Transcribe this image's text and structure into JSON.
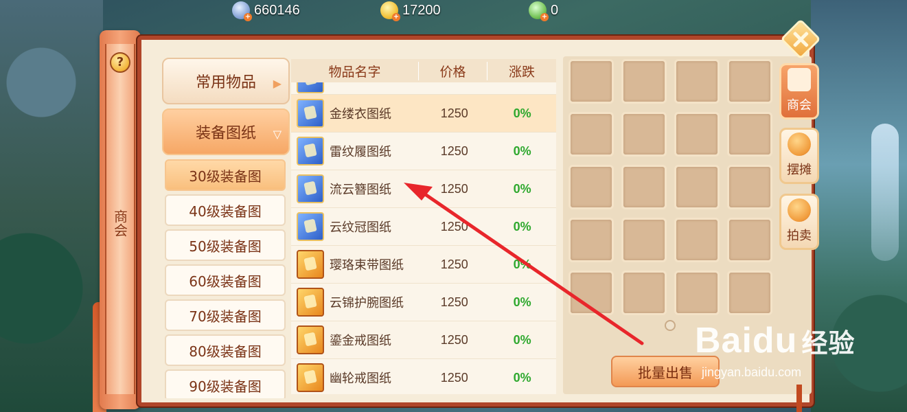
{
  "currencies": [
    {
      "icon": "silver-coin-icon",
      "value": "660146"
    },
    {
      "icon": "gold-coin-icon",
      "value": "17200"
    },
    {
      "icon": "jade-coin-icon",
      "value": "0"
    }
  ],
  "spine": {
    "help": "?",
    "title": "商会"
  },
  "categories": {
    "main": [
      {
        "label": "常用物品",
        "arrow": "▶",
        "active": false
      },
      {
        "label": "装备图纸",
        "arrow": "▽",
        "active": true
      }
    ],
    "sub": [
      {
        "label": "30级装备图",
        "active": true
      },
      {
        "label": "40级装备图",
        "active": false
      },
      {
        "label": "50级装备图",
        "active": false
      },
      {
        "label": "60级装备图",
        "active": false
      },
      {
        "label": "70级装备图",
        "active": false
      },
      {
        "label": "80级装备图",
        "active": false
      },
      {
        "label": "90级装备图",
        "active": false
      }
    ]
  },
  "table": {
    "headers": {
      "name": "物品名字",
      "price": "价格",
      "change": "涨跌"
    },
    "rows": [
      {
        "name": "金缕衣图纸",
        "price": "1250",
        "change": "0%",
        "book": "blue",
        "selected": true
      },
      {
        "name": "雷纹履图纸",
        "price": "1250",
        "change": "0%",
        "book": "blue",
        "selected": false
      },
      {
        "name": "流云簪图纸",
        "price": "1250",
        "change": "0%",
        "book": "blue",
        "selected": false
      },
      {
        "name": "云纹冠图纸",
        "price": "1250",
        "change": "0%",
        "book": "blue",
        "selected": false
      },
      {
        "name": "璎珞束带图纸",
        "price": "1250",
        "change": "0%",
        "book": "orange",
        "selected": false
      },
      {
        "name": "云锦护腕图纸",
        "price": "1250",
        "change": "0%",
        "book": "orange",
        "selected": false
      },
      {
        "name": "鎏金戒图纸",
        "price": "1250",
        "change": "0%",
        "book": "orange",
        "selected": false
      },
      {
        "name": "幽轮戒图纸",
        "price": "1250",
        "change": "0%",
        "book": "orange",
        "selected": false
      }
    ]
  },
  "inventory": {
    "slot_count": 20,
    "batch_sell_label": "批量出售"
  },
  "side_tabs": [
    {
      "label": "商会",
      "icon": "chamber-icon",
      "active": true
    },
    {
      "label": "摆摊",
      "icon": "coins-icon",
      "active": false
    },
    {
      "label": "拍卖",
      "icon": "auction-coins-icon",
      "active": false
    }
  ],
  "annotation": {
    "color": "#e8262b"
  },
  "watermark": {
    "logo": "Baidu",
    "logo_cn": "经验",
    "url": "jingyan.baidu.com"
  }
}
